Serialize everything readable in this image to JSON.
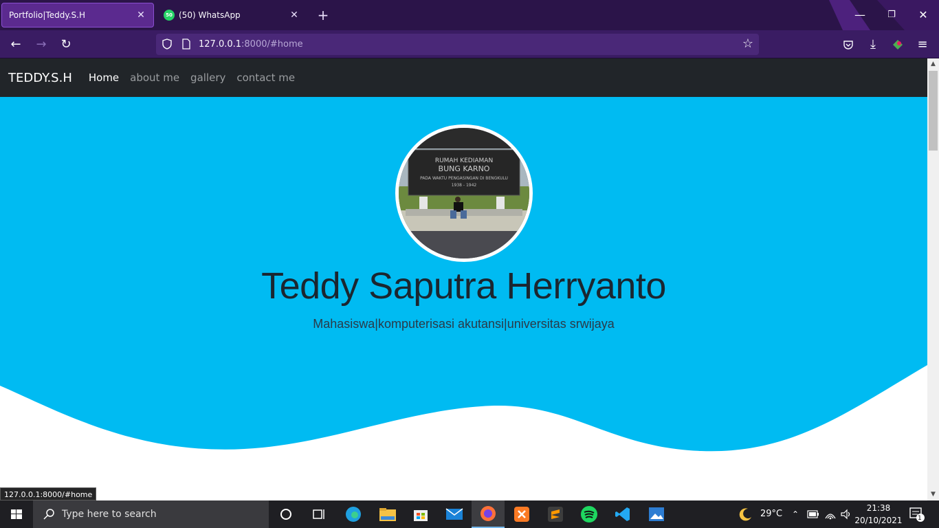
{
  "browser": {
    "tabs": [
      {
        "title": "Portfolio|Teddy.S.H",
        "active": true
      },
      {
        "title": "(50) WhatsApp",
        "active": false,
        "favicon_badge": "50"
      }
    ],
    "url_host": "127.0.0.1",
    "url_path": ":8000/#home",
    "status_url": "127.0.0.1:8000/#home"
  },
  "site": {
    "brand": "TEDDY.S.H",
    "nav": [
      "Home",
      "about me",
      "gallery",
      "contact me"
    ],
    "hero_name": "Teddy Saputra Herryanto",
    "hero_subtitle": "Mahasiswa|komputerisasi akutansi|universitas srwijaya",
    "photo_caption": {
      "line1": "RUMAH KEDIAMAN",
      "line2": "BUNG KARNO",
      "line3": "PADA WAKTU PENGASINGAN DI BENGKULU",
      "line4": "1938 - 1942"
    }
  },
  "taskbar": {
    "search_placeholder": "Type here to search",
    "weather": "29°C",
    "time": "21:38",
    "date": "20/10/2021",
    "notification_count": "1"
  },
  "colors": {
    "hero_bg": "#00bbf2",
    "navbar_bg": "#212529",
    "browser_tabstrip": "#2b1449",
    "browser_toolbar": "#3a1c63"
  }
}
